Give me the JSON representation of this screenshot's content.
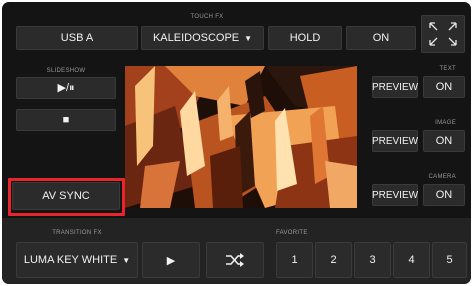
{
  "source": {
    "label": "USB A"
  },
  "touch_fx": {
    "heading": "TOUCH FX",
    "effect_label": "KALEIDOSCOPE",
    "hold_label": "HOLD",
    "on_label": "ON"
  },
  "fullscreen": {
    "icon": "expand-arrows-icon"
  },
  "slideshow": {
    "heading": "SLIDESHOW",
    "play_pause_glyph": "▶/⏸",
    "stop_glyph": "■"
  },
  "av_sync": {
    "label": "AV SYNC",
    "highlight_color": "#e8252b"
  },
  "text": {
    "heading": "TEXT",
    "preview_label": "PREVIEW",
    "on_label": "ON"
  },
  "image": {
    "heading": "IMAGE",
    "preview_label": "PREVIEW",
    "on_label": "ON"
  },
  "camera": {
    "heading": "CAMERA",
    "preview_label": "PREVIEW",
    "on_label": "ON"
  },
  "transition_fx": {
    "heading": "TRANSITION FX",
    "effect_label": "LUMA KEY WHITE",
    "play_glyph": "▶",
    "shuffle_icon": "shuffle-icon"
  },
  "favorite": {
    "heading": "FAVORITE",
    "slots": [
      "1",
      "2",
      "3",
      "4",
      "5"
    ]
  }
}
